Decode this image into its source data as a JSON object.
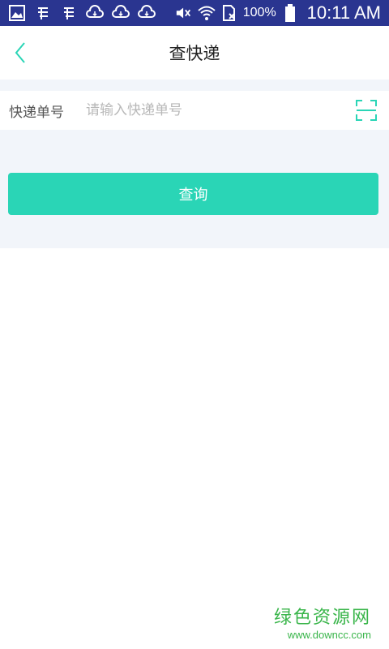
{
  "status_bar": {
    "battery_percent": "100%",
    "time": "10:11 AM"
  },
  "header": {
    "title": "查快递"
  },
  "form": {
    "label": "快递单号",
    "placeholder": "请输入快递单号",
    "value": "",
    "submit_label": "查询"
  },
  "watermark": {
    "title": "绿色资源网",
    "url": "www.downcc.com"
  },
  "colors": {
    "status_bar": "#2a3590",
    "accent": "#2ad5b6",
    "page_bg": "#f2f5fa",
    "watermark": "#39b54a"
  }
}
